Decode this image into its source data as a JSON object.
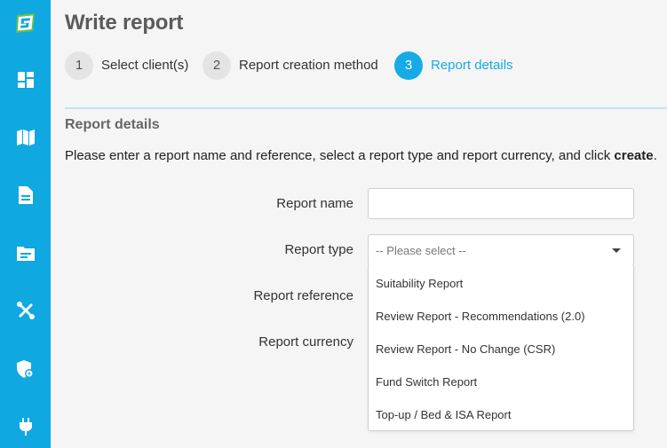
{
  "sidebar": {
    "color": "#0fa8e0",
    "items": [
      {
        "icon": "brand-logo-icon"
      },
      {
        "icon": "dashboard-icon"
      },
      {
        "icon": "map-icon"
      },
      {
        "icon": "document-icon"
      },
      {
        "icon": "folder-icon"
      },
      {
        "icon": "tools-icon"
      },
      {
        "icon": "shield-settings-icon"
      },
      {
        "icon": "plug-icon"
      }
    ]
  },
  "header": {
    "title": "Write report"
  },
  "steps": [
    {
      "number": "1",
      "label": "Select client(s)",
      "active": false
    },
    {
      "number": "2",
      "label": "Report creation method",
      "active": false
    },
    {
      "number": "3",
      "label": "Report details",
      "active": true
    }
  ],
  "form": {
    "section_title": "Report details",
    "instructions_prefix": "Please enter a report name and reference, select a report type and report currency, and click ",
    "instructions_action": "create",
    "instructions_suffix": ".",
    "report_name_label": "Report name",
    "report_name_value": "",
    "report_type_label": "Report type",
    "report_type_selected": "-- Please select --",
    "report_reference_label": "Report reference",
    "report_currency_label": "Report currency",
    "report_type_options": [
      "Suitability Report",
      "Review Report - Recommendations (2.0)",
      "Review Report - No Change (CSR)",
      "Fund Switch Report",
      "Top-up / Bed & ISA Report"
    ]
  },
  "colors": {
    "accent": "#16abe5",
    "sidebar": "#0fa8e0",
    "logo_green": "#6cc04a"
  }
}
